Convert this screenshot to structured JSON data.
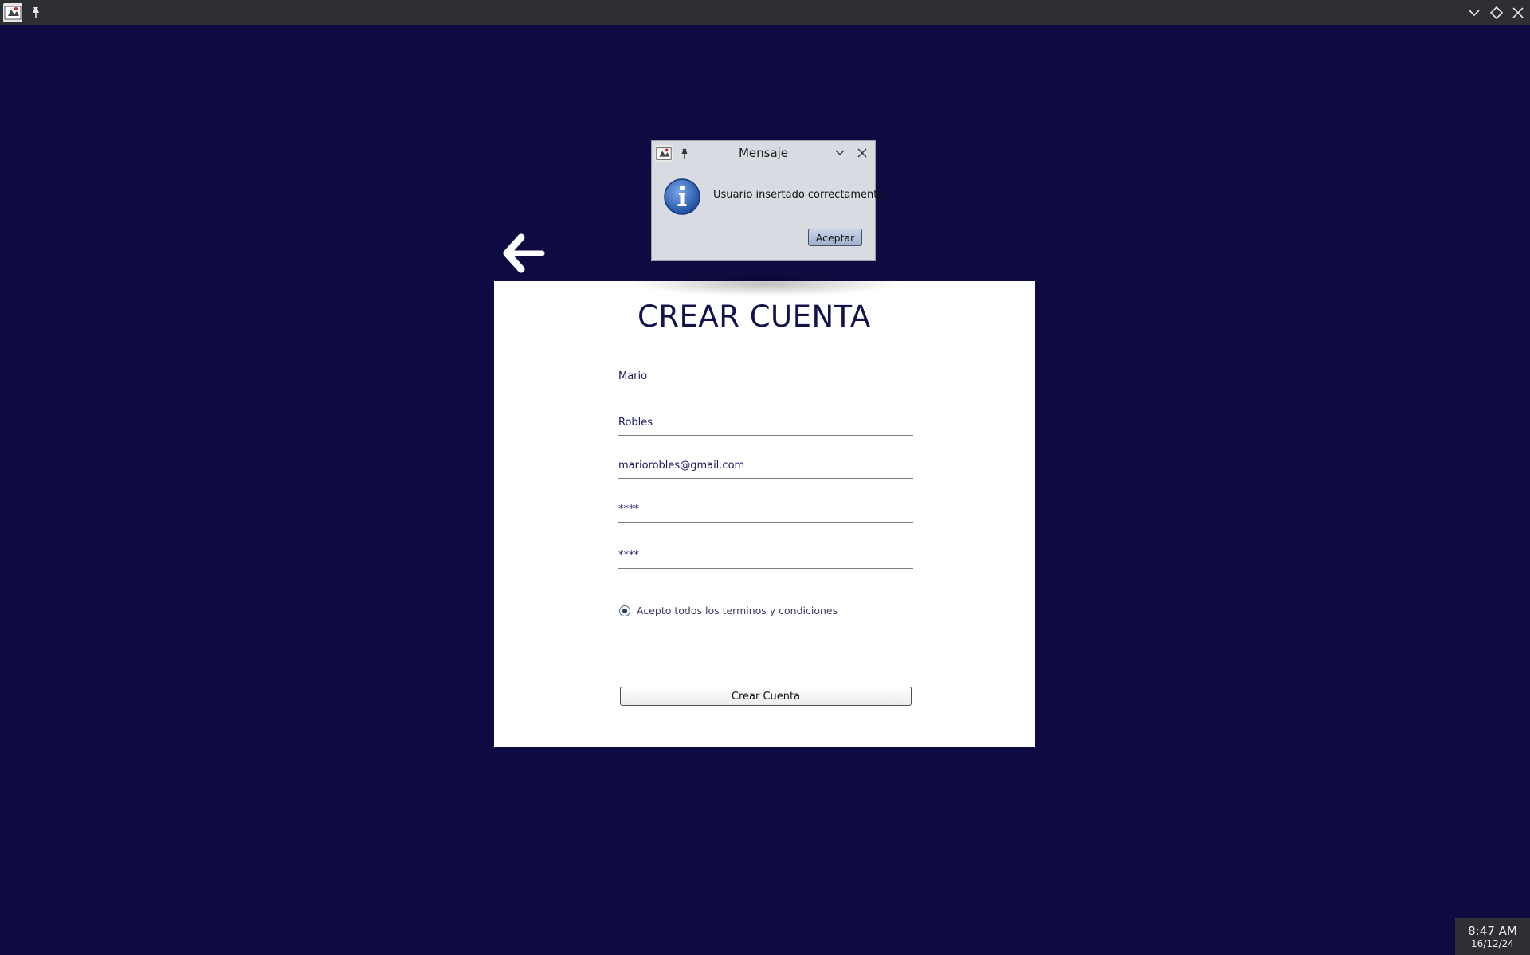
{
  "window": {
    "controls": [
      "chevron-down",
      "restore",
      "close"
    ]
  },
  "form": {
    "title": "CREAR CUENTA",
    "fields": [
      {
        "name": "first-name",
        "value": "Mario"
      },
      {
        "name": "last-name",
        "value": "Robles"
      },
      {
        "name": "email",
        "value": "mariorobles@gmail.com"
      },
      {
        "name": "password",
        "value": "****"
      },
      {
        "name": "confirm-password",
        "value": "****"
      }
    ],
    "terms_label": "Acepto todos los terminos y condiciones",
    "terms_checked": true,
    "submit_label": "Crear Cuenta"
  },
  "dialog": {
    "title": "Mensaje",
    "message": "Usuario insertado correctamente.",
    "ok_label": "Aceptar",
    "icon": "info-icon"
  },
  "clock": {
    "time": "8:47 AM",
    "date": "16/12/24"
  },
  "colors": {
    "background": "#0e0b43",
    "panel": "#ffffff",
    "title_text": "#14124a",
    "topbar": "#2d2f33"
  }
}
